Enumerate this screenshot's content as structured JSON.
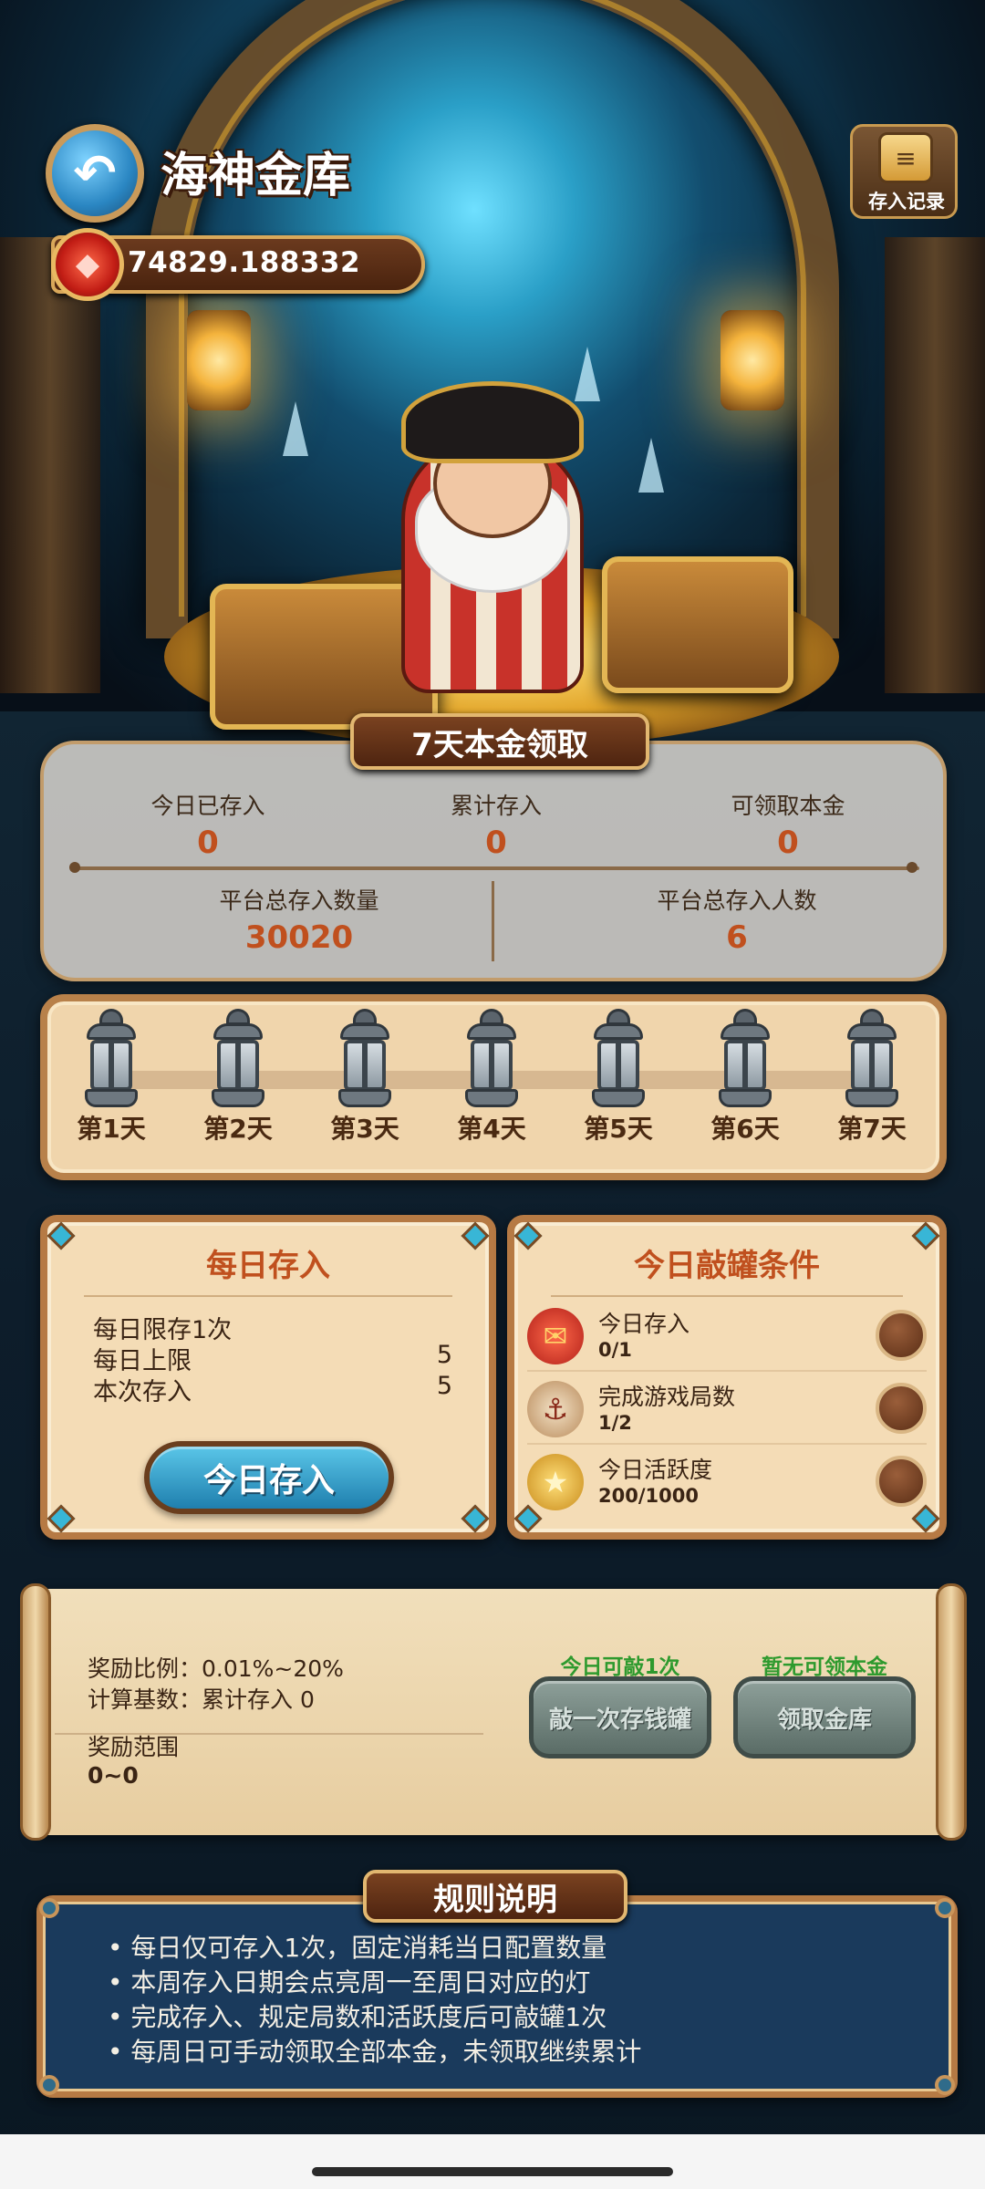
{
  "header": {
    "title": "海神金库",
    "balance": "74829.188332",
    "record_label": "存入记录"
  },
  "principal": {
    "section_title": "7天本金领取",
    "stats": [
      {
        "label": "今日已存入",
        "value": "0"
      },
      {
        "label": "累计存入",
        "value": "0"
      },
      {
        "label": "可领取本金",
        "value": "0"
      }
    ],
    "platform_stats": [
      {
        "label": "平台总存入数量",
        "value": "30020"
      },
      {
        "label": "平台总存入人数",
        "value": "6"
      }
    ]
  },
  "days": [
    "第1天",
    "第2天",
    "第3天",
    "第4天",
    "第5天",
    "第6天",
    "第7天"
  ],
  "daily_deposit": {
    "title": "每日存入",
    "rows": [
      {
        "label": "每日限存1次",
        "value": ""
      },
      {
        "label": "每日上限",
        "value": "5"
      },
      {
        "label": "本次存入",
        "value": "5"
      }
    ],
    "button": "今日存入"
  },
  "conditions": {
    "title": "今日敲罐条件",
    "items": [
      {
        "name": "今日存入",
        "progress": "0/1",
        "icon": "gift-icon"
      },
      {
        "name": "完成游戏局数",
        "progress": "1/2",
        "icon": "game-icon"
      },
      {
        "name": "今日活跃度",
        "progress": "200/1000",
        "icon": "star-medal-icon"
      }
    ]
  },
  "reward": {
    "ratio": "奖励比例：0.01%~20%",
    "base": "计算基数：累计存入 0",
    "range_label": "奖励范围",
    "range_value": "0~0",
    "smash_note": "今日可敲1次",
    "smash_button": "敲一次存钱罐",
    "claim_note": "暂无可领本金",
    "claim_button": "领取金库"
  },
  "rules": {
    "title": "规则说明",
    "items": [
      "• 每日仅可存入1次，固定消耗当日配置数量",
      "• 本周存入日期会点亮周一至周日对应的灯",
      "• 完成存入、规定局数和活跃度后可敲罐1次",
      "• 每周日可手动领取全部本金，未领取继续累计"
    ]
  },
  "colors": {
    "accent_orange": "#c0501e",
    "deposit_blue": "#1f7fae",
    "note_green": "#2e9a2e",
    "rules_navy": "#1a3a5c"
  }
}
